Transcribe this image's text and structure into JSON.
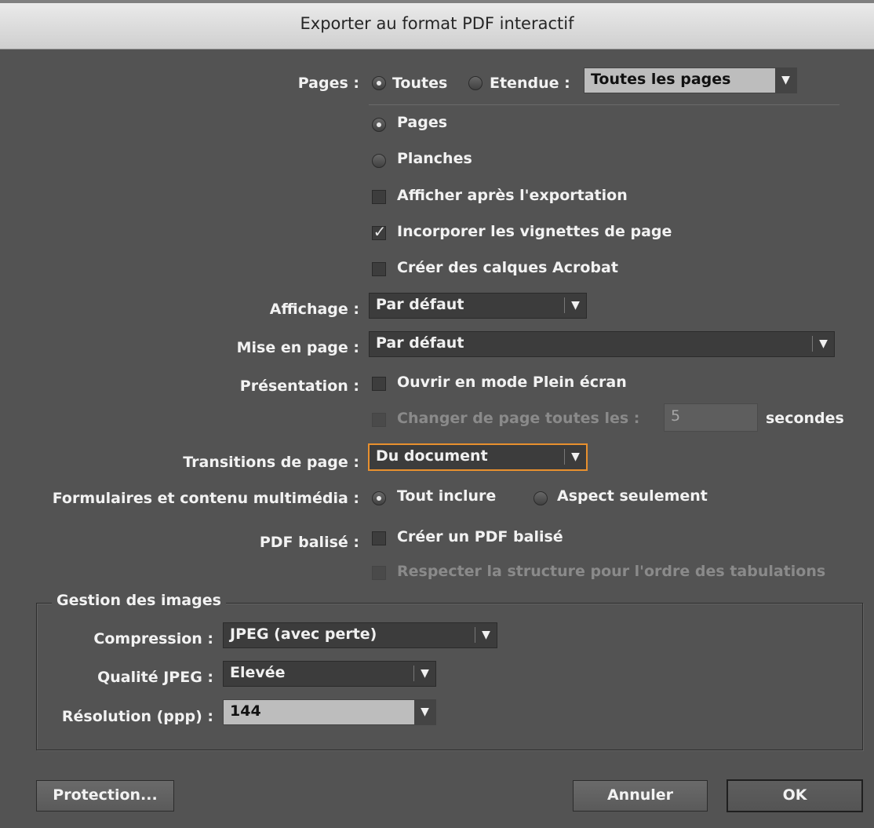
{
  "dialog": {
    "title": "Exporter au format PDF interactif"
  },
  "pages": {
    "label": "Pages :",
    "all_label": "Toutes",
    "range_label": "Etendue :",
    "range_value": "Toutes les pages",
    "pages_label": "Pages",
    "spreads_label": "Planches",
    "view_after": "Afficher après l'exportation",
    "embed_thumbs": "Incorporer les vignettes de page",
    "acrobat_layers": "Créer des calques Acrobat"
  },
  "display": {
    "label": "Affichage :",
    "value": "Par défaut"
  },
  "layout": {
    "label": "Mise en page :",
    "value": "Par défaut"
  },
  "presentation": {
    "label": "Présentation :",
    "fullscreen": "Ouvrir en mode Plein écran",
    "flip_every": "Changer de page toutes les :",
    "seconds_value": "5",
    "seconds_label": "secondes"
  },
  "transitions": {
    "label": "Transitions de page :",
    "value": "Du document"
  },
  "forms": {
    "label": "Formulaires et contenu multimédia :",
    "include_all": "Tout inclure",
    "appearance_only": "Aspect seulement"
  },
  "tagged": {
    "label": "PDF balisé :",
    "create": "Créer un PDF balisé",
    "tab_order": "Respecter la structure pour l'ordre des tabulations"
  },
  "images": {
    "legend": "Gestion des images",
    "compression_label": "Compression :",
    "compression_value": "JPEG (avec perte)",
    "quality_label": "Qualité JPEG :",
    "quality_value": "Elevée",
    "resolution_label": "Résolution (ppp) :",
    "resolution_value": "144"
  },
  "buttons": {
    "protection": "Protection...",
    "cancel": "Annuler",
    "ok": "OK"
  },
  "icons": {
    "check": "✓",
    "arrow": "▼"
  },
  "colors": {
    "background": "#535353",
    "focus": "#e8902e",
    "titlebar": "#dcdcdc"
  }
}
